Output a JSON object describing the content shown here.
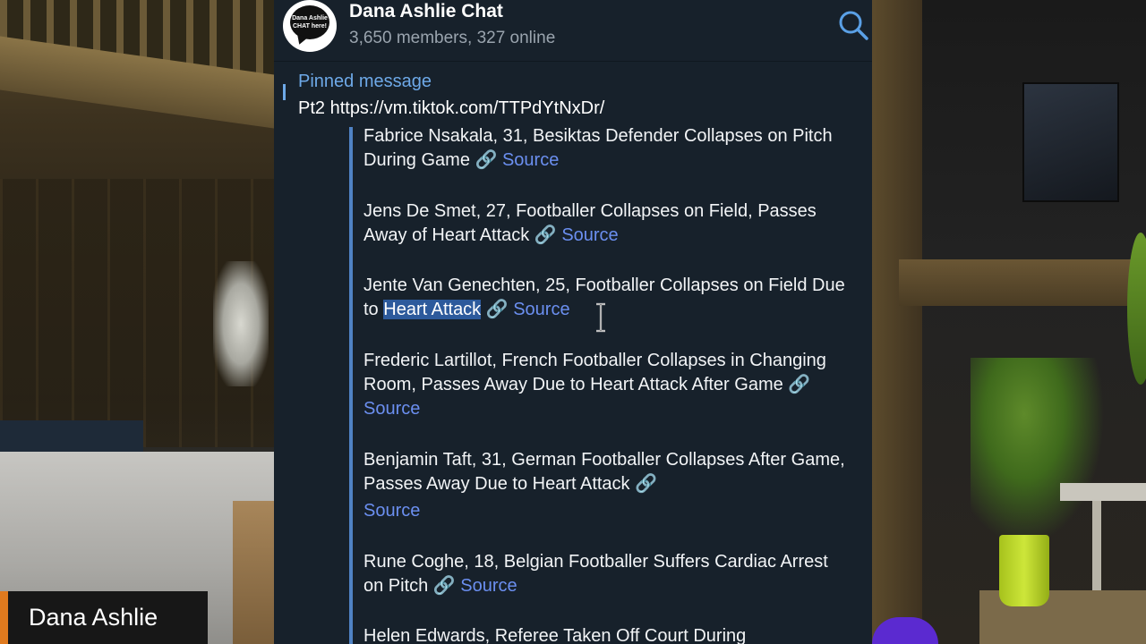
{
  "chat": {
    "title": "Dana Ashlie Chat",
    "subtitle": "3,650 members, 327 online",
    "avatar_text": "Dana Ashlie CHAT here!"
  },
  "pinned": {
    "label": "Pinned message",
    "text": "Pt2 https://vm.tiktok.com/TTPdYtNxDr/"
  },
  "entries": [
    {
      "text": "Fabrice Nsakala, 31, Besiktas Defender Collapses on Pitch During Game",
      "link": "Source"
    },
    {
      "text": "Jens De Smet, 27, Footballer Collapses on Field, Passes Away of Heart Attack",
      "link": "Source"
    },
    {
      "text_before": "Jente Van Genechten, 25, Footballer Collapses on Field Due to ",
      "highlight": "Heart Attack",
      "link": "Source"
    },
    {
      "text": "Frederic Lartillot, French Footballer Collapses in Changing Room, Passes Away Due to Heart Attack After Game",
      "link": "Source"
    },
    {
      "text": "Benjamin Taft, 31, German Footballer Collapses After Game, Passes Away Due to Heart Attack",
      "link": "Source"
    },
    {
      "text": "Rune Coghe, 18, Belgian Footballer Suffers Cardiac Arrest on Pitch",
      "link": "Source"
    },
    {
      "text": "Helen Edwards, Referee Taken Off Court During"
    }
  ],
  "overlay": {
    "name_tag": "Dana Ashlie",
    "accent_color": "#e07a1e"
  },
  "colors": {
    "panel_bg": "#17212b",
    "link": "#6b8ff0",
    "pinned_accent": "#6ea9e8",
    "selection": "#2d5a9c"
  },
  "icons": {
    "search": "search-icon",
    "link": "link-icon",
    "cursor": "text-cursor-icon"
  }
}
